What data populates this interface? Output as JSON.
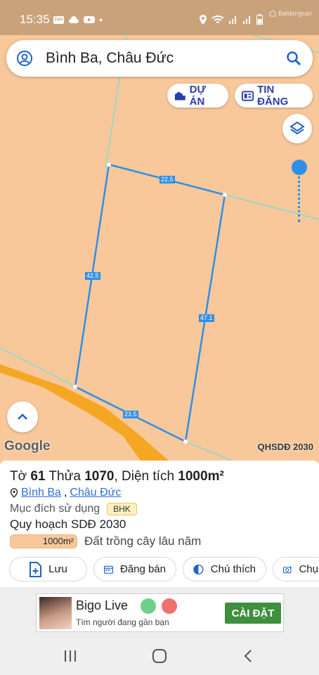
{
  "status": {
    "time": "15:35",
    "watermark": "Batdongsan"
  },
  "search": {
    "query": "Bình Ba, Châu Đức"
  },
  "chips": {
    "duan": "DỰ ÁN",
    "tindang": "TIN ĐĂNG"
  },
  "map": {
    "dimensions": [
      "22.5",
      "42.5",
      "47.1",
      "23.5"
    ],
    "google": "Google",
    "layer_name": "QHSDĐ 2030",
    "colors": {
      "land": "#f8c89b",
      "boundary": "#2f8fe6",
      "road": "#f5a623",
      "accent_line": "#9bd9c5"
    }
  },
  "info": {
    "title_prefix": "Tờ ",
    "sheet": "61",
    "mid": " Thửa ",
    "parcel": "1070",
    "area_label": ", Diện tích ",
    "area": "1000m²",
    "ward": "Bình Ba",
    "separator": ",",
    "district": "Châu Đức",
    "purpose_label": "Mục đích sử dụng",
    "purpose_code": "BHK",
    "plan": "Quy hoạch SDĐ 2030",
    "plan_area": "1000m²",
    "plan_desc": "Đất trồng cây lâu năm"
  },
  "actions": {
    "save": "Lưu",
    "post": "Đăng bán",
    "legend": "Chú thích",
    "capture": "Chụ"
  },
  "ad": {
    "title": "Bigo Live",
    "subtitle": "Tìm người đang gần bạn",
    "cta": "CÀI ĐẶT"
  }
}
